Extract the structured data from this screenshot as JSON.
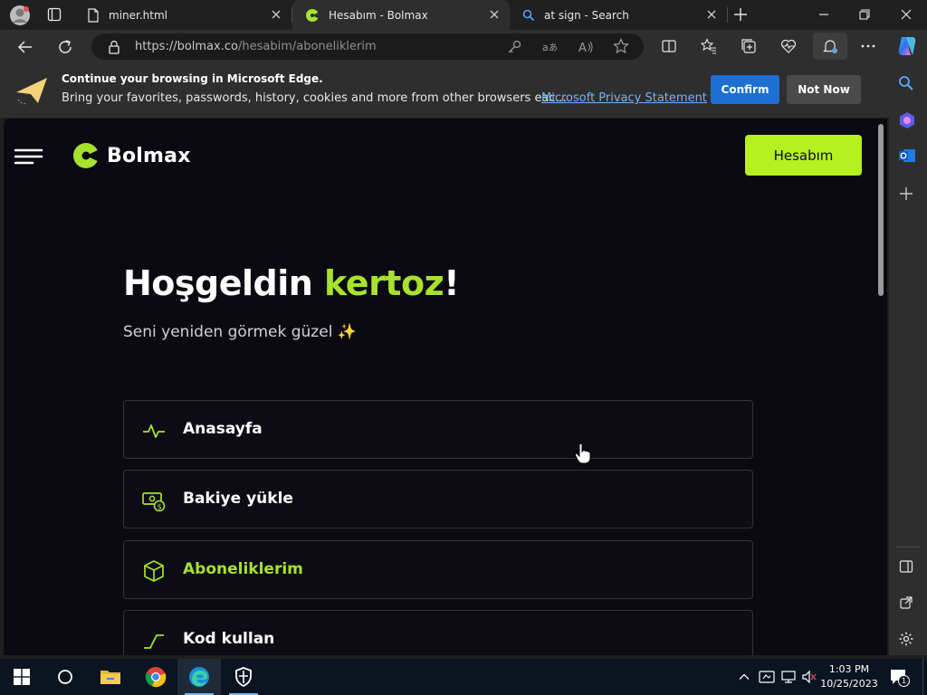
{
  "browser": {
    "tabs": [
      {
        "title": "miner.html",
        "icon": "file-icon",
        "active": false
      },
      {
        "title": "Hesabım - Bolmax",
        "icon": "bolmax-favicon",
        "active": true
      },
      {
        "title": "at sign - Search",
        "icon": "search-icon",
        "active": false
      }
    ],
    "address": {
      "url_host": "https://bolmax.co",
      "url_path": "/hesabim/aboneliklerim"
    },
    "infobar": {
      "title": "Continue your browsing in Microsoft Edge.",
      "text": "Bring your favorites, passwords, history, cookies and more from other browsers eac...",
      "link": "Microsoft Privacy Statement",
      "confirm_label": "Confirm",
      "not_now_label": "Not Now"
    }
  },
  "site": {
    "brand": "Bolmax",
    "account_button": "Hesabım",
    "welcome_prefix": "Hoşgeldin ",
    "username": "kertoz",
    "welcome_suffix": "!",
    "subtitle": "Seni yeniden görmek güzel ✨",
    "menu": [
      {
        "label": "Anasayfa",
        "icon": "activity-icon",
        "active": false
      },
      {
        "label": "Bakiye yükle",
        "icon": "money-icon",
        "active": false
      },
      {
        "label": "Aboneliklerim",
        "icon": "box-icon",
        "active": true
      },
      {
        "label": "Kod kullan",
        "icon": "code-icon",
        "active": false
      }
    ],
    "accent_color": "#a6e22e"
  },
  "taskbar": {
    "time": "1:03 PM",
    "date": "10/25/2023",
    "notification_count": "1"
  }
}
